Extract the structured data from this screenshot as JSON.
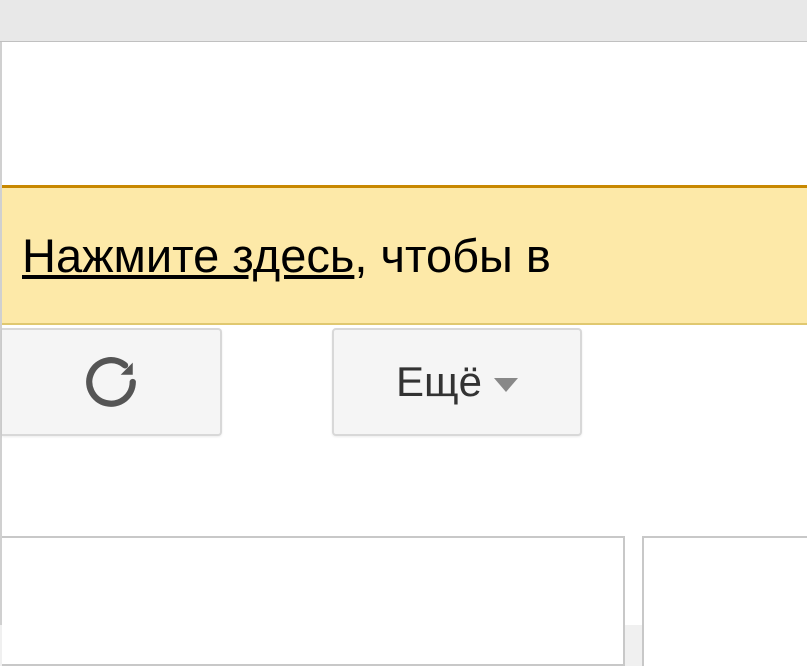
{
  "notification": {
    "link_text": "Нажмите здесь",
    "rest_text": ", чтобы в"
  },
  "toolbar": {
    "refresh_title": "Обновить",
    "more_label": "Ещё"
  }
}
